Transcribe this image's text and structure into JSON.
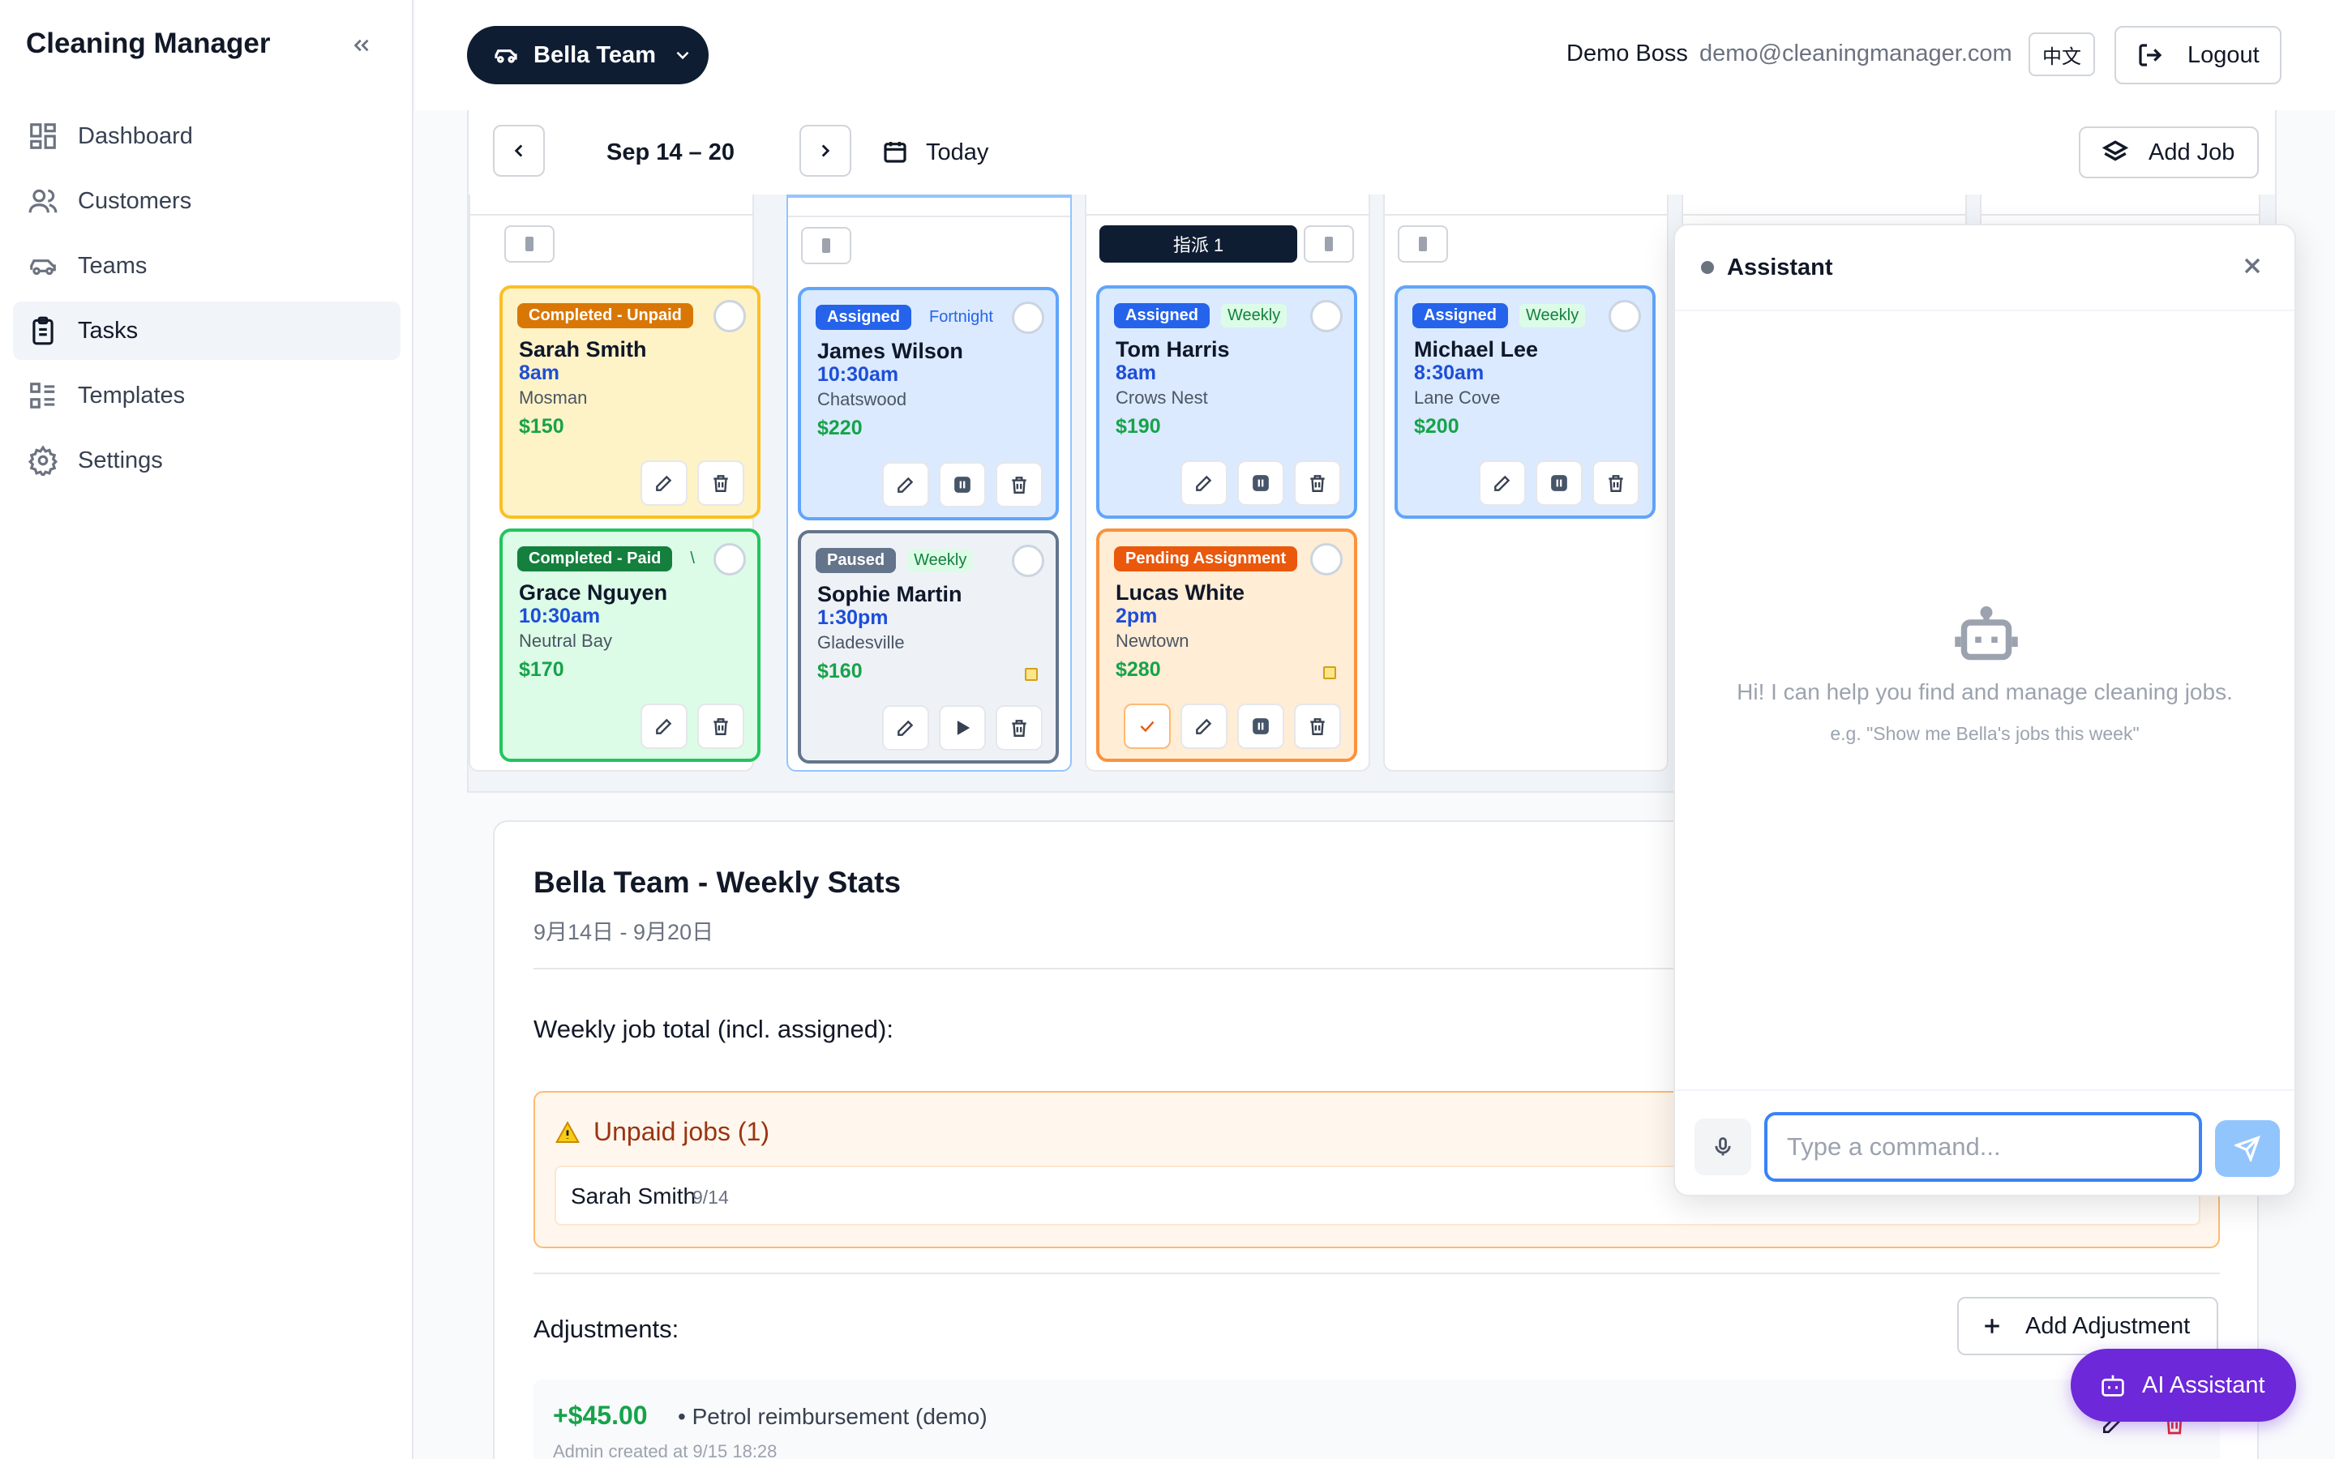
{
  "app": {
    "title": "Cleaning Manager"
  },
  "sidebar": {
    "items": [
      {
        "label": "Dashboard",
        "icon": "dashboard-icon"
      },
      {
        "label": "Customers",
        "icon": "users-icon"
      },
      {
        "label": "Teams",
        "icon": "car-icon"
      },
      {
        "label": "Tasks",
        "icon": "clipboard-icon",
        "active": true
      },
      {
        "label": "Templates",
        "icon": "list-icon"
      },
      {
        "label": "Settings",
        "icon": "gear-icon"
      }
    ]
  },
  "header": {
    "team": "Bella Team",
    "user_name": "Demo Boss",
    "user_email": "demo@cleaningmanager.com",
    "lang": "中文",
    "logout": "Logout"
  },
  "weekbar": {
    "range": "Sep 14 – 20",
    "today": "Today",
    "add_job": "Add Job"
  },
  "calendar": {
    "assign_chip": "指派 1",
    "jobs": [
      {
        "status": "Completed - Unpaid",
        "freq": "",
        "name": "Sarah Smith",
        "time": "8am",
        "location": "Mosman",
        "price": "$150"
      },
      {
        "status": "Completed - Paid",
        "freq": "\\",
        "name": "Grace Nguyen",
        "time": "10:30am",
        "location": "Neutral Bay",
        "price": "$170"
      },
      {
        "status": "Assigned",
        "freq": "Fortnight",
        "name": "James Wilson",
        "time": "10:30am",
        "location": "Chatswood",
        "price": "$220"
      },
      {
        "status": "Paused",
        "freq": "Weekly",
        "name": "Sophie Martin",
        "time": "1:30pm",
        "location": "Gladesville",
        "price": "$160"
      },
      {
        "status": "Assigned",
        "freq": "Weekly",
        "name": "Tom Harris",
        "time": "8am",
        "location": "Crows Nest",
        "price": "$190"
      },
      {
        "status": "Pending Assignment",
        "freq": "",
        "name": "Lucas White",
        "time": "2pm",
        "location": "Newtown",
        "price": "$280"
      },
      {
        "status": "Assigned",
        "freq": "Weekly",
        "name": "Michael Lee",
        "time": "8:30am",
        "location": "Lane Cove",
        "price": "$200"
      }
    ]
  },
  "stats": {
    "title": "Bella Team - Weekly Stats",
    "subtitle": "9月14日 - 9月20日",
    "weekly_total_label": "Weekly job total (incl. assigned):",
    "unpaid_title": "Unpaid jobs (1)",
    "unpaid_items": [
      {
        "name": "Sarah Smith",
        "date": "9/14"
      }
    ],
    "adjustments_label": "Adjustments:",
    "add_adjustment": "Add Adjustment",
    "adjustments": [
      {
        "amount": "+$45.00",
        "desc": "• Petrol reimbursement (demo)",
        "meta": "Admin created at 9/15 18:28"
      }
    ]
  },
  "assistant": {
    "title": "Assistant",
    "hint": "Hi! I can help you find and manage cleaning jobs.",
    "example": "e.g. \"Show me Bella's jobs this week\"",
    "placeholder": "Type a command..."
  },
  "ai_button": "AI Assistant",
  "colors": {
    "completed_unpaid": "#d97706",
    "completed_paid": "#15803d",
    "assigned": "#2563eb",
    "paused": "#64748b",
    "pending": "#ea580c",
    "accent_purple": "#6d28d9",
    "navy": "#0f1d33"
  }
}
